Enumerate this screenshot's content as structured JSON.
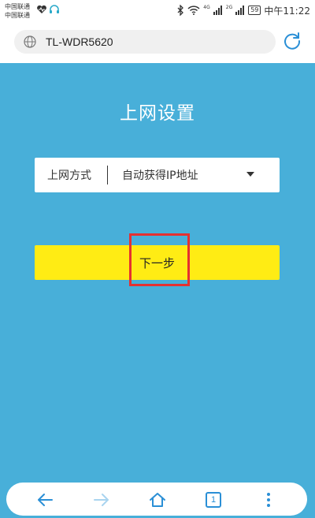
{
  "status_bar": {
    "carrier1": "中国联通",
    "carrier2": "中国联通",
    "network_4g": "4G",
    "network_2g": "2G",
    "battery": "59",
    "time": "中午11:22"
  },
  "browser": {
    "url": "TL-WDR5620"
  },
  "page": {
    "title": "上网设置",
    "connection_label": "上网方式",
    "connection_value": "自动获得IP地址",
    "next_label": "下一步"
  },
  "colors": {
    "background": "#48afd9",
    "button": "#ffec14",
    "highlight": "#e53030"
  },
  "nav": {
    "tab_count": "1"
  }
}
